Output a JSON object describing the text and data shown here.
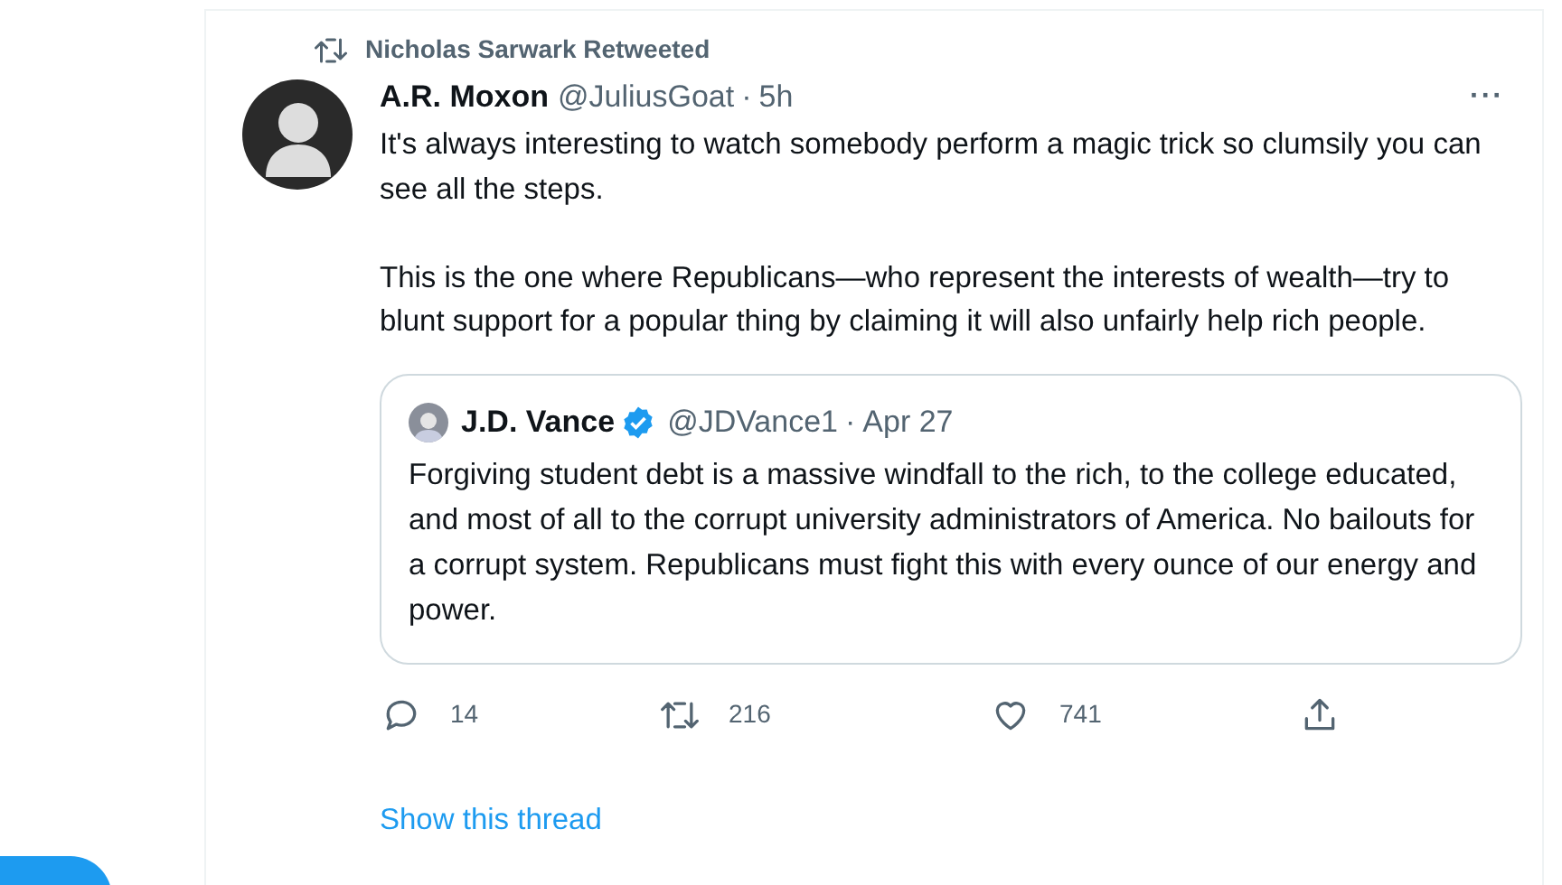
{
  "retweet_header": "Nicholas Sarwark Retweeted",
  "tweet": {
    "author_name": "A.R. Moxon",
    "handle": "@JuliusGoat",
    "separator": "·",
    "time": "5h",
    "more": "···",
    "paragraphs": [
      "It's always interesting to watch somebody perform a magic trick so clumsily you can see all the steps.",
      "This is the one where Republicans—who represent the interests of wealth—try to blunt support for a popular thing by claiming it will also unfairly help rich people."
    ],
    "quoted": {
      "author_name": "J.D. Vance",
      "verified": true,
      "handle": "@JDVance1",
      "separator": "·",
      "date": "Apr 27",
      "text": "Forgiving student debt is a massive windfall to the rich, to the college educated, and most of all to the corrupt university administrators of America. No bailouts for a corrupt system. Republicans must fight this with every ounce of our energy and power."
    },
    "actions": [
      {
        "kind": "reply",
        "count": "14"
      },
      {
        "kind": "retweet",
        "count": "216"
      },
      {
        "kind": "like",
        "count": "741"
      },
      {
        "kind": "share"
      }
    ]
  },
  "show_thread": "Show this thread"
}
